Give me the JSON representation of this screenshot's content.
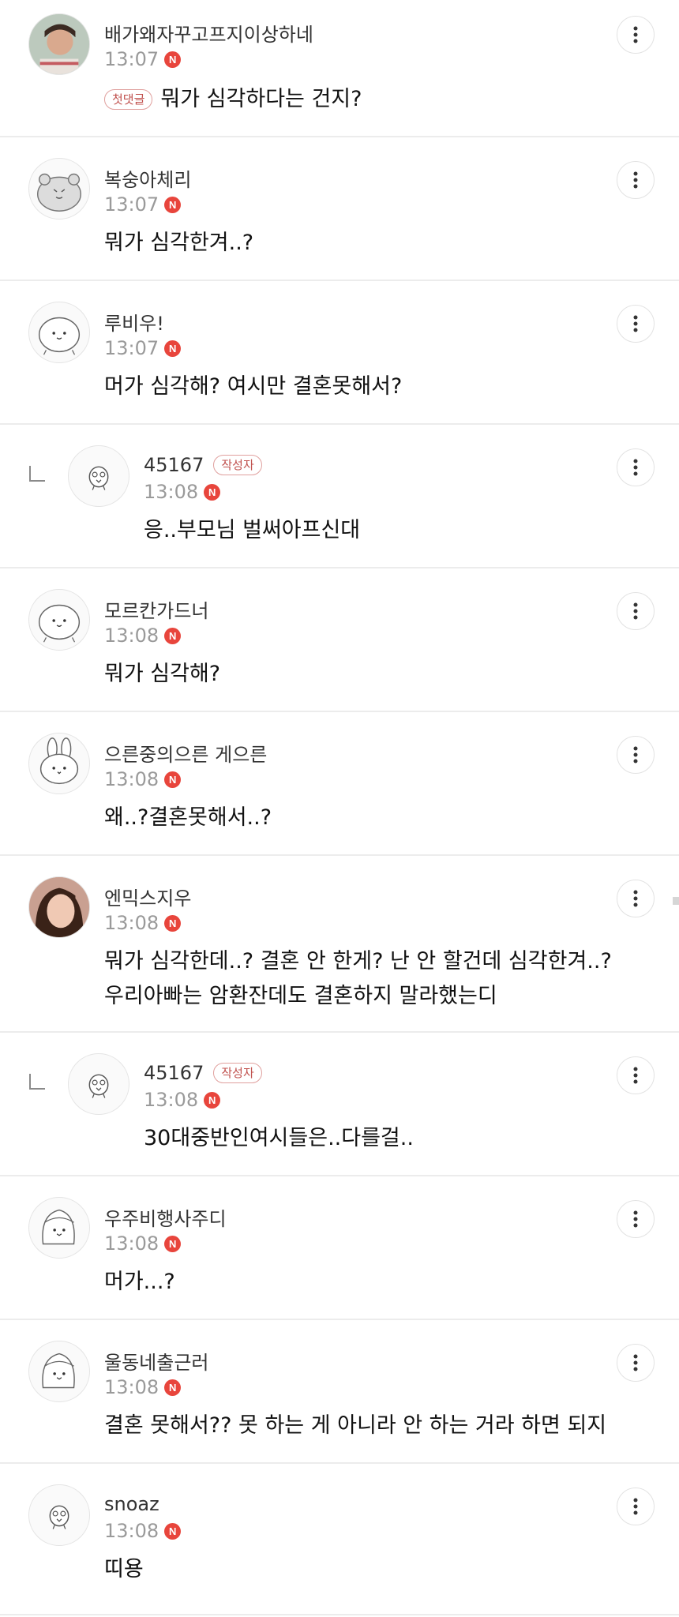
{
  "comments": [
    {
      "nickname": "배가왜자꾸고프지이상하네",
      "time": "13:07",
      "new": "N",
      "first_badge": "첫댓글",
      "text": "뭐가 심각하다는 건지?"
    },
    {
      "nickname": "복숭아체리",
      "time": "13:07",
      "new": "N",
      "text": "뭐가 심각한겨..?"
    },
    {
      "nickname": "루비우!",
      "time": "13:07",
      "new": "N",
      "text": "머가 심각해? 여시만 결혼못해서?"
    },
    {
      "nickname": "45167",
      "author_badge": "작성자",
      "time": "13:08",
      "new": "N",
      "text": "응..부모님 벌써아프신대"
    },
    {
      "nickname": "모르칸가드너",
      "time": "13:08",
      "new": "N",
      "text": "뭐가 심각해?"
    },
    {
      "nickname": "으른중의으른 게으른",
      "time": "13:08",
      "new": "N",
      "text": "왜..?결혼못해서..?"
    },
    {
      "nickname": "엔믹스지우",
      "time": "13:08",
      "new": "N",
      "text": "뭐가 심각한데..? 결혼 안 한게? 난 안 할건데 심각한겨..?",
      "text2": "우리아빠는 암환잔데도 결혼하지 말라했는디"
    },
    {
      "nickname": "45167",
      "author_badge": "작성자",
      "time": "13:08",
      "new": "N",
      "text": "30대중반인여시들은..다를걸.."
    },
    {
      "nickname": "우주비행사주디",
      "time": "13:08",
      "new": "N",
      "text": "머가...?"
    },
    {
      "nickname": "울동네출근러",
      "time": "13:08",
      "new": "N",
      "text": "결혼 못해서?? 못 하는 게 아니라 안 하는 거라 하면 되지"
    },
    {
      "nickname": "snoaz",
      "time": "13:08",
      "new": "N",
      "text": "띠용"
    }
  ],
  "icons": {
    "more": "more-vertical-icon",
    "reply": "reply-arrow-icon"
  },
  "colors": {
    "new_badge": "#e8453c",
    "author_badge": "#c0504d",
    "divider": "#ececec"
  }
}
